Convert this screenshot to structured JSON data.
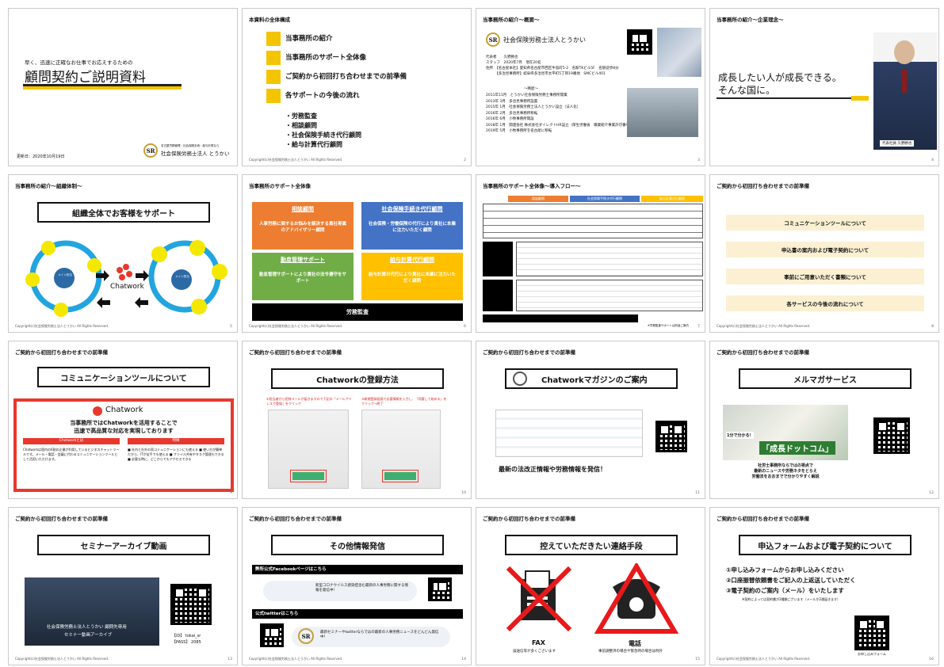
{
  "copyright": "Copyright(c)社会保険労務士法人とうかい All Rights Reserved.",
  "slides": {
    "s1": {
      "subtitle": "早く、迅速に正確なお仕事でお応えするための",
      "title": "顧問契約ご説明資料",
      "date": "更新日：2020年10月19日",
      "org_small": "名古屋労務管理・社会保険手続・給与計算なら",
      "org": "社会保険労務士法人 とうかい",
      "logo_text": "SR"
    },
    "s2": {
      "header": "本資料の全体構成",
      "items": [
        "当事務所の紹介",
        "当事務所のサポート全体像",
        "ご契約から初回打ち合わせまでの前準備",
        "各サポートの今後の流れ"
      ],
      "subitems": [
        "・労務監査",
        "・相談顧問",
        "・社会保険手続き代行顧問",
        "・給与計算代行顧問"
      ],
      "page": "2"
    },
    "s3": {
      "header": "当事務所の紹介～概要～",
      "org": "社会保険労務士法人とうかい",
      "rows": [
        "代表者　　久野勝也",
        "スタッフ　2020年7月　現在20名",
        "住所　【名古屋本社】愛知県名古屋市西区牛島町5-2　名駅TKビル5F　名駅徒歩8分",
        "　　　【多治見事務所】岐阜県多治見市太平町5丁目19番地　SMCビル401"
      ],
      "history_title": "～略歴～",
      "history": [
        "2011年11月　とうかい社会保険労務士事務所開業",
        "2013年 3月　多治見事務所設置",
        "2015年 1月　社会保険労務士法人とうかい設立（法人化）",
        "2016年 2月　多治見事務所移転",
        "2016年 6月　小牧事務所開設",
        "2018年 1月　関連会社 株式会社ダイレクトHR設立（厚生労働省　職業紹介事業許可番号794）",
        "2019年 5月　小牧事務所を名古屋に移転"
      ],
      "page": "3"
    },
    "s4": {
      "header": "当事務所の紹介～企業理念～",
      "motto1": "成長したい人が成長できる。",
      "motto2": "そんな国に。",
      "caption": "代表社員 久野勝也",
      "page": "4"
    },
    "s5": {
      "header": "当事務所の紹介～組織体制～",
      "box": "組織全体でお客様をサポート",
      "center_left": "メイン担当",
      "center_right": "メイン担当",
      "node": "担当",
      "node2": "専門担当",
      "brand": "Chatwork",
      "page": "5"
    },
    "s6": {
      "header": "当事務所のサポート全体像",
      "cells": [
        {
          "title": "相談顧問",
          "body": "人事労務に関するお悩みを解決する貴社専属のアドバイザリー顧問",
          "color": "#ed7d31"
        },
        {
          "title": "社会保険手続き代行顧問",
          "body": "社会保険・労働保険の代行により貴社に本業に注力いただく顧問",
          "color": "#4472c4"
        },
        {
          "title": "勤怠管理サポート",
          "body": "勤怠管理サポートにより貴社の法令遵守をサポート",
          "color": "#70ad47"
        },
        {
          "title": "給与計算代行顧問",
          "body": "給与計算の代行により貴社に本業に注力いただく顧問",
          "color": "#ffc000"
        }
      ],
      "bottom": "労務監査",
      "page": "6"
    },
    "s7": {
      "header": "当事務所のサポート全体像～導入フロー～",
      "cols": [
        "相談顧問",
        "社会保険手続き代行顧問",
        "給与計算代行顧問"
      ],
      "footnote": "※労務監査サポートは別途ご案内",
      "page": "7"
    },
    "s8": {
      "header": "ご契約から初回打ち合わせまでの前準備",
      "items": [
        "コミュニケーションツールについて",
        "申込書の案内および電子契約について",
        "事前にご用意いただく書類について",
        "各サービスの今後の流れについて"
      ],
      "page": "8"
    },
    "s9": {
      "header": "ご契約から初回打ち合わせまでの前準備",
      "box": "コミュニケーションツールについて",
      "brand": "Chatwork",
      "lead1": "当事務所ではChatworkを活用することで",
      "lead2": "迅速で高品質な対応を実現しております",
      "left_title": "Chatworkとは",
      "left_body": "Chatworkは国内の6割の企業が利用しているビジネスチャットツールです。メール・電話・会議に代わるコミュニケーションツールとして活用いただけます。",
      "right_title": "特徴",
      "right_body": "■ 社内と社外の両コミュニケーションにも使える ■ 使い方が簡単だから、ITが苦手でも使える ■ ファイル共有やタスク管理もできる ■ 必要な時に、どこからでもアクセスできる",
      "page": "9"
    },
    "s10": {
      "header": "ご契約から初回打ち合わせまでの前準備",
      "box": "Chatworkの登録方法",
      "step1": "①担当者から招待メールが届きますので下記の「メールアドレスで登録」をクリック",
      "step2": "②新規登録画面で必要情報を入力し、「同意して始める」をクリック→終了",
      "page": "10"
    },
    "s11": {
      "header": "ご契約から初回打ち合わせまでの前準備",
      "box": "Chatworkマガジンのご案内",
      "lead": "最新の法改正情報や労務情報を発信！",
      "page": "11"
    },
    "s12": {
      "header": "ご契約から初回打ち合わせまでの前準備",
      "box": "メルマガサービス",
      "banner_small": "1分で分かる！",
      "banner_big": "「成長ドットコム」",
      "caption1": "社労士事務所ならではの視点で",
      "caption2": "最新のニュースや労務ネタをとらえ",
      "caption3": "労働法をおおまでで分かりやすく解説",
      "page": "12"
    },
    "s13": {
      "header": "ご契約から初回打ち合わせまでの前準備",
      "box": "セミナーアーカイブ動画",
      "video_caption1": "社会保険労務士法人とうかい 顧問先専用",
      "video_caption2": "セミナー動画アーカイブ",
      "id": "【ID】 tokai_sr",
      "pass": "【PASS】 2085",
      "page": "13"
    },
    "s14": {
      "header": "ご契約から初回打ち合わせまでの前準備",
      "box": "その他情報発信",
      "fb_bar": "弊所公式Facebookページはこちら",
      "fb_text": "新型コロナウイルス感染症含む最新の人事労務に関する情報を発信中！",
      "tw_bar": "公式twitterはこちら",
      "tw_text": "最新セミナーやtwitterならではの最新の人事労務ニュースをどんどん発信中！",
      "page": "14"
    },
    "s15": {
      "header": "ご契約から初回打ち合わせまでの前準備",
      "box": "控えていただきたい連絡手段",
      "fax": "FAX",
      "fax_note": "誤送信等が多くございます",
      "tel": "電話",
      "tel_note": "事前調整済の場合や緊急時の場合は例外",
      "page": "15"
    },
    "s16": {
      "header": "ご契約から初回打ち合わせまでの前準備",
      "box": "申込フォームおよび電子契約について",
      "lines": [
        "①申し込みフォームからお申し込みください",
        "②口座振替依頼書をご記入の上返送していただく",
        "③電子契約のご案内（メール）をいたします"
      ],
      "note": "※契約によっては契約書が2種類ございます（メールが2通届きます）",
      "qr_caption": "お申し込みフォーム",
      "page": "16"
    }
  }
}
